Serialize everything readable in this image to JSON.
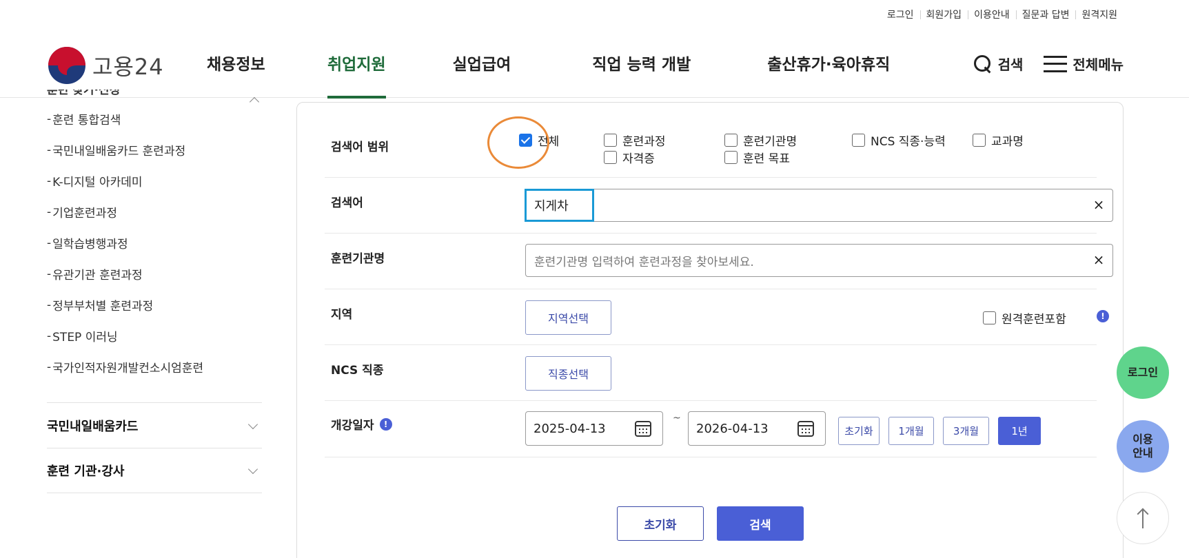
{
  "util_links": [
    "로그인",
    "회원가입",
    "이용안내",
    "질문과 답변",
    "원격지원"
  ],
  "logo": {
    "text": "고용24"
  },
  "nav": [
    {
      "label": "채용정보",
      "active": false
    },
    {
      "label": "취업지원",
      "active": true
    },
    {
      "label": "실업급여",
      "active": false
    },
    {
      "label": "직업 능력 개발",
      "active": false
    },
    {
      "label": "출산휴가·육아휴직",
      "active": false
    }
  ],
  "header_buttons": {
    "search": "검색",
    "menu": "전체메뉴"
  },
  "sidebar": {
    "section_title_partial": "훈련 찾기·신청",
    "sub_items": [
      "훈련 통합검색",
      "국민내일배움카드 훈련과정",
      "K-디지털 아카데미",
      "기업훈련과정",
      "일학습병행과정",
      "유관기관 훈련과정",
      "정부부처별 훈련과정",
      "STEP 이러닝",
      "국가인적자원개발컨소시엄훈련"
    ],
    "groups": [
      "국민내일배움카드",
      "훈련 기관·강사"
    ]
  },
  "form": {
    "scope": {
      "label": "검색어 범위",
      "options": [
        {
          "label": "전체",
          "checked": true
        },
        {
          "label": "훈련과정",
          "checked": false
        },
        {
          "label": "자격증",
          "checked": false
        },
        {
          "label": "훈련기관명",
          "checked": false
        },
        {
          "label": "훈련 목표",
          "checked": false
        },
        {
          "label": "NCS 직종·능력",
          "checked": false
        },
        {
          "label": "교과명",
          "checked": false
        }
      ]
    },
    "keyword": {
      "label": "검색어",
      "value": "지게차"
    },
    "institution": {
      "label": "훈련기관명",
      "placeholder": "훈련기관명 입력하여 훈련과정을 찾아보세요."
    },
    "region": {
      "label": "지역",
      "button": "지역선택",
      "remote_label": "원격훈련포함",
      "remote_checked": false
    },
    "ncs": {
      "label": "NCS 직종",
      "button": "직종선택"
    },
    "date": {
      "label": "개강일자",
      "start": "2025-04-13",
      "end": "2026-04-13",
      "separator": "~",
      "quick": [
        {
          "label": "초기화",
          "active": false
        },
        {
          "label": "1개월",
          "active": false
        },
        {
          "label": "3개월",
          "active": false
        },
        {
          "label": "1년",
          "active": true
        }
      ]
    },
    "actions": {
      "reset": "초기화",
      "search": "검색"
    }
  },
  "floating": {
    "login": "로그인",
    "guide_line1": "이용",
    "guide_line2": "안내"
  },
  "icons": {
    "clear": "×",
    "info": "!"
  },
  "colors": {
    "brand_green": "#1f6b3a",
    "primary_blue": "#4a5fd6",
    "annotation_orange": "#ea8a38",
    "annotation_blue": "#1a9ad6"
  }
}
